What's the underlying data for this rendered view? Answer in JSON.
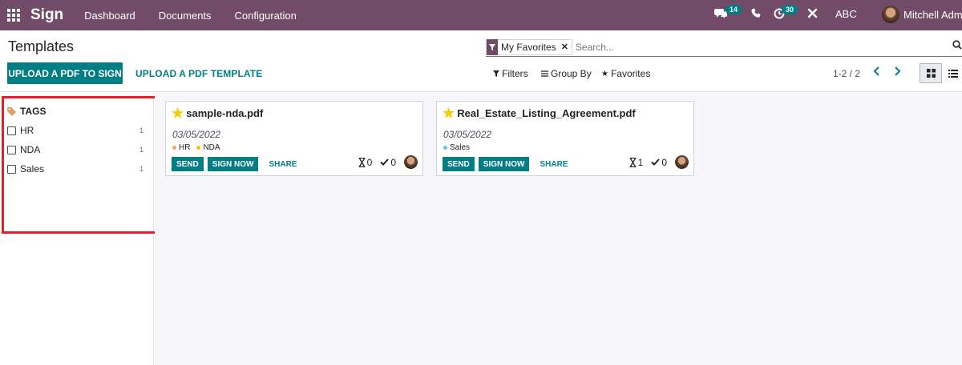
{
  "navbar": {
    "app_name": "Sign",
    "menu": [
      "Dashboard",
      "Documents",
      "Configuration"
    ],
    "messages_count": "14",
    "activities_count": "30",
    "company": "ABC",
    "user_name": "Mitchell Admin",
    "bg_color": "#714b67"
  },
  "control_panel": {
    "title": "Templates",
    "primary_button": "UPLOAD A PDF TO SIGN",
    "secondary_button": "UPLOAD A PDF TEMPLATE",
    "search": {
      "facet": "My Favorites",
      "placeholder": "Search..."
    },
    "filters": "Filters",
    "group_by": "Group By",
    "favorites": "Favorites",
    "pager": "1-2 / 2"
  },
  "sidebar": {
    "header": "TAGS",
    "tags": [
      {
        "label": "HR",
        "count": "1"
      },
      {
        "label": "NDA",
        "count": "1"
      },
      {
        "label": "Sales",
        "count": "1"
      }
    ]
  },
  "cards": [
    {
      "name": "sample-nda.pdf",
      "date": "03/05/2022",
      "tags": [
        {
          "label": "HR",
          "color": "#f4a460"
        },
        {
          "label": "NDA",
          "color": "#f0c419"
        }
      ],
      "send": "SEND",
      "sign_now": "SIGN NOW",
      "share": "SHARE",
      "in_progress": "0",
      "signed": "0"
    },
    {
      "name": "Real_Estate_Listing_Agreement.pdf",
      "date": "03/05/2022",
      "tags": [
        {
          "label": "Sales",
          "color": "#6cc1ed"
        }
      ],
      "send": "SEND",
      "sign_now": "SIGN NOW",
      "share": "SHARE",
      "in_progress": "1",
      "signed": "0"
    }
  ],
  "colors": {
    "accent": "#017e84",
    "brand": "#714b67",
    "highlight": "#e3202a",
    "star": "#f3cc00"
  }
}
